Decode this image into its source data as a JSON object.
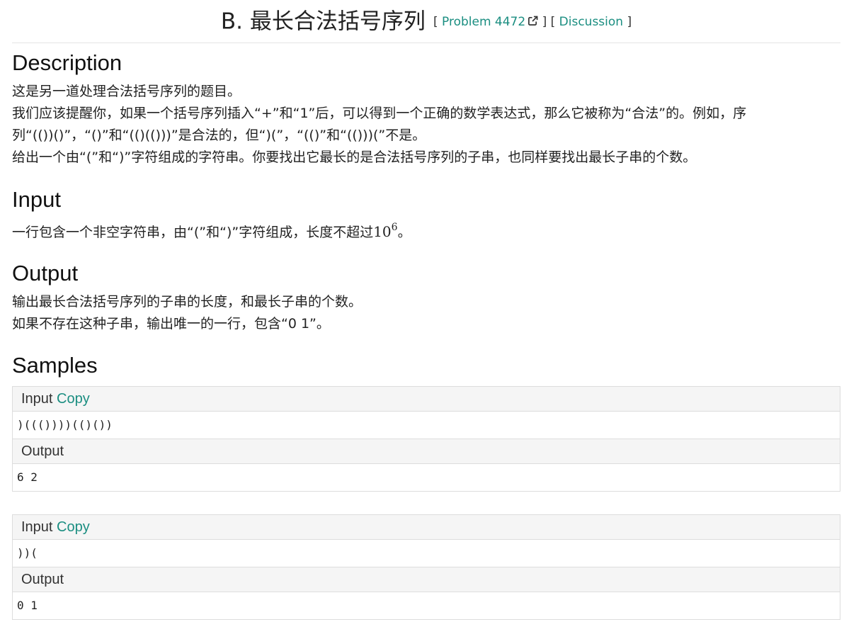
{
  "header": {
    "title": "B. 最长合法括号序列",
    "bracket_open": "[",
    "problem_link": "Problem 4472",
    "bracket_mid": "] [",
    "discussion_link": "Discussion",
    "bracket_close": "]"
  },
  "description": {
    "heading": "Description",
    "lines": [
      "这是另一道处理合法括号序列的题目。",
      "我们应该提醒你，如果一个括号序列插入“+”和“1”后，可以得到一个正确的数学表达式，那么它被称为“合法”的。例如，序",
      "列“(())()”，“()”和“(()(()))”是合法的，但“)(”，“(()”和“(()))(”不是。",
      "给出一个由“(”和“)”字符组成的字符串。你要找出它最长的是合法括号序列的子串，也同样要找出最长子串的个数。"
    ]
  },
  "input": {
    "heading": "Input",
    "text_before": "一行包含一个非空字符串，由“(”和“)”字符组成，长度不超过",
    "math_base": "10",
    "math_exp": "6",
    "text_after": "。"
  },
  "output": {
    "heading": "Output",
    "lines": [
      "输出最长合法括号序列的子串的长度，和最长子串的个数。",
      "如果不存在这种子串，输出唯一的一行，包含“0 1”。"
    ]
  },
  "samples": {
    "heading": "Samples",
    "input_label": "Input",
    "copy_label": "Copy",
    "output_label": "Output",
    "items": [
      {
        "input": ")((())))(()())",
        "output": "6 2"
      },
      {
        "input": "))(",
        "output": "0 1"
      }
    ]
  },
  "colors": {
    "link": "#1b8e81",
    "panel_header_bg": "#f5f5f5",
    "border": "#dddddd"
  }
}
